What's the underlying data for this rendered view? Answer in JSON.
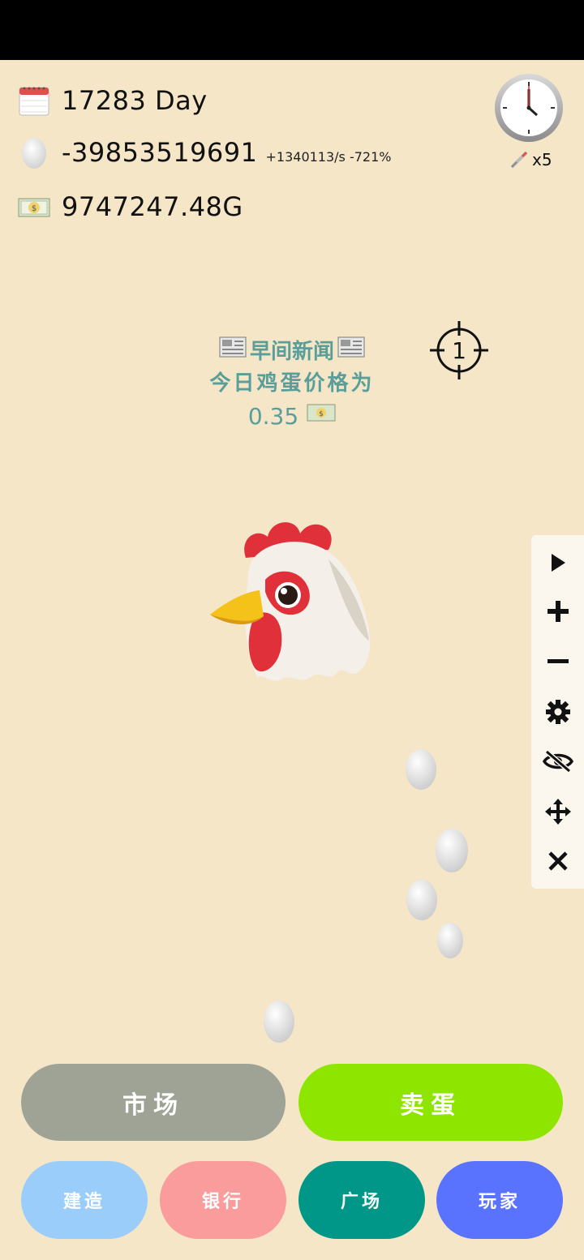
{
  "stats": {
    "day": "17283 Day",
    "eggs": "-39853519691",
    "egg_rate": "+1340113/s -721%",
    "money": "9747247.48G"
  },
  "speed": {
    "multiplier": "x5"
  },
  "news": {
    "title": "早间新闻",
    "headline": "今日鸡蛋价格为",
    "price": "0.35"
  },
  "crosshair": {
    "count": "1"
  },
  "toolbar": [
    "play-icon",
    "plus-icon",
    "minus-icon",
    "gear-icon",
    "eye-off-icon",
    "move-icon",
    "close-icon"
  ],
  "buttons": {
    "market": "市场",
    "sell_eggs": "卖蛋",
    "build": "建造",
    "bank": "银行",
    "plaza": "广场",
    "players": "玩家"
  },
  "colors": {
    "background": "#f5e6c8",
    "market": "#9fa396",
    "sell": "#8ee600",
    "build": "#9bcdfb",
    "bank": "#fa9c9c",
    "plaza": "#009688",
    "players": "#5a73ff",
    "news_text": "#5a9e9a"
  }
}
